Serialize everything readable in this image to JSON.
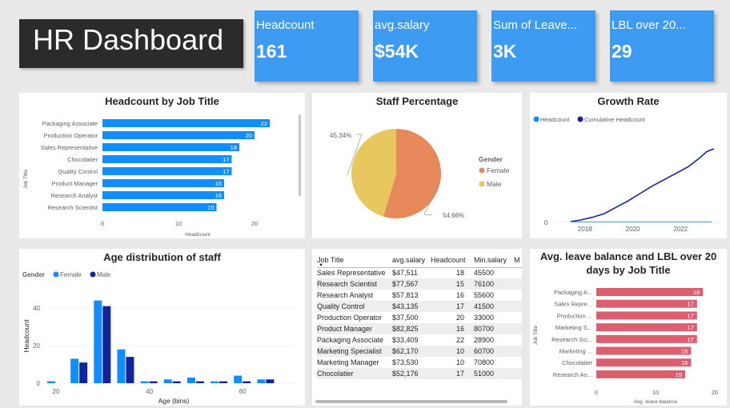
{
  "dashboard_title": "HR Dashboard",
  "kpis": [
    {
      "label": "Headcount",
      "value": "161"
    },
    {
      "label": "avg.salary",
      "value": "$54K"
    },
    {
      "label": "Sum of Leave...",
      "value": "3K"
    },
    {
      "label": "LBL over 20...",
      "value": "29"
    }
  ],
  "colors": {
    "accent": "#3d9bf1",
    "bar_blue": "#118dff",
    "dark_blue": "#12239e",
    "female": "#e8895c",
    "male": "#e8c85e",
    "leave_bar": "#dd5f6f"
  },
  "headcount_by_job": {
    "title": "Headcount by Job Title",
    "ylabel": "Job Title",
    "xlabel": "Headcount",
    "chart_data": {
      "type": "bar",
      "orientation": "horizontal",
      "categories": [
        "Packaging Associate",
        "Production Operator",
        "Sales Representative",
        "Chocolatier",
        "Quality Control",
        "Product Manager",
        "Research Analyst",
        "Research Scientist"
      ],
      "values": [
        22,
        20,
        18,
        17,
        17,
        16,
        16,
        15
      ],
      "xticks": [
        "0",
        "10",
        "20"
      ],
      "xlim": [
        0,
        25
      ]
    }
  },
  "staff_percentage": {
    "title": "Staff Percentage",
    "legend_title": "Gender",
    "chart_data": {
      "type": "pie",
      "categories": [
        "Female",
        "Male"
      ],
      "values": [
        54.66,
        45.34
      ],
      "labels": [
        "54.66%",
        "45.34%"
      ]
    }
  },
  "growth_rate": {
    "title": "Growth Rate",
    "chart_data": {
      "type": "line",
      "series": [
        {
          "name": "Headcount",
          "color": "#118dff",
          "x": [
            2017.4,
            2018,
            2019,
            2020,
            2021,
            2022,
            2023.3
          ],
          "y": [
            1,
            1,
            1,
            1,
            1,
            1,
            1
          ]
        },
        {
          "name": "Cumulative Headcount",
          "color": "#12239e",
          "x": [
            2017.4,
            2017.8,
            2018.3,
            2018.8,
            2019.3,
            2019.8,
            2020.3,
            2020.8,
            2021.3,
            2021.8,
            2022.3,
            2022.8,
            2023.1,
            2023.4
          ],
          "y": [
            2,
            5,
            11,
            19,
            33,
            47,
            63,
            79,
            93,
            107,
            121,
            141,
            155,
            161
          ]
        }
      ],
      "xticks": [
        "2018",
        "2020",
        "2022"
      ],
      "xlim": [
        2016.9,
        2023.6
      ],
      "ylim": [
        0,
        175
      ]
    }
  },
  "age_distribution": {
    "title": "Age distribution of staff",
    "legend_title": "Gender",
    "xlabel": "Age (bins)",
    "ylabel": "Headcount",
    "chart_data": {
      "type": "bar",
      "x": [
        20,
        25,
        30,
        35,
        40,
        45,
        50,
        55,
        60,
        65
      ],
      "series": [
        {
          "name": "Female",
          "color": "#118dff",
          "values": [
            1,
            13,
            44,
            18,
            1,
            2,
            3,
            1,
            4,
            2
          ]
        },
        {
          "name": "Male",
          "color": "#12239e",
          "values": [
            0,
            11,
            41,
            14,
            1,
            1,
            1,
            1,
            1,
            2
          ]
        }
      ],
      "xticks": [
        "20",
        "40",
        "60"
      ],
      "yticks": [
        "0",
        "20",
        "40"
      ],
      "ylim": [
        0,
        50
      ]
    }
  },
  "salary_table": {
    "columns": [
      "Job Title",
      "avg.salary",
      "Headcount",
      "Min.salary",
      "M"
    ],
    "rows": [
      [
        "Sales Representative",
        "$47,511",
        "18",
        "45500"
      ],
      [
        "Research Scientist",
        "$77,567",
        "15",
        "76100"
      ],
      [
        "Research Analyst",
        "$57,813",
        "16",
        "55600"
      ],
      [
        "Quality Control",
        "$43,135",
        "17",
        "41500"
      ],
      [
        "Production Operator",
        "$37,500",
        "20",
        "33000"
      ],
      [
        "Product Manager",
        "$82,825",
        "16",
        "80700"
      ],
      [
        "Packaging Associate",
        "$33,409",
        "22",
        "28900"
      ],
      [
        "Marketing Specialist",
        "$62,170",
        "10",
        "60700"
      ],
      [
        "Marketing Manager",
        "$73,530",
        "10",
        "70800"
      ],
      [
        "Chocolatier",
        "$52,176",
        "17",
        "51000"
      ]
    ]
  },
  "leave_balance": {
    "title_line1": "Avg. leave balance and LBL over 20",
    "title_line2": "days by Job Title",
    "ylabel": "Job Title",
    "xlabel": "Avg. leave balance",
    "chart_data": {
      "type": "bar",
      "orientation": "horizontal",
      "categories": [
        "Packaging A...",
        "Sales Repre...",
        "Production ...",
        "Marketing S...",
        "Research Sci...",
        "Marketing ...",
        "Chocolatier",
        "Research An..."
      ],
      "values": [
        18,
        17,
        17,
        17,
        17,
        16,
        16,
        15
      ],
      "xticks": [
        "0",
        "10",
        "20"
      ],
      "xlim": [
        0,
        20
      ]
    }
  }
}
